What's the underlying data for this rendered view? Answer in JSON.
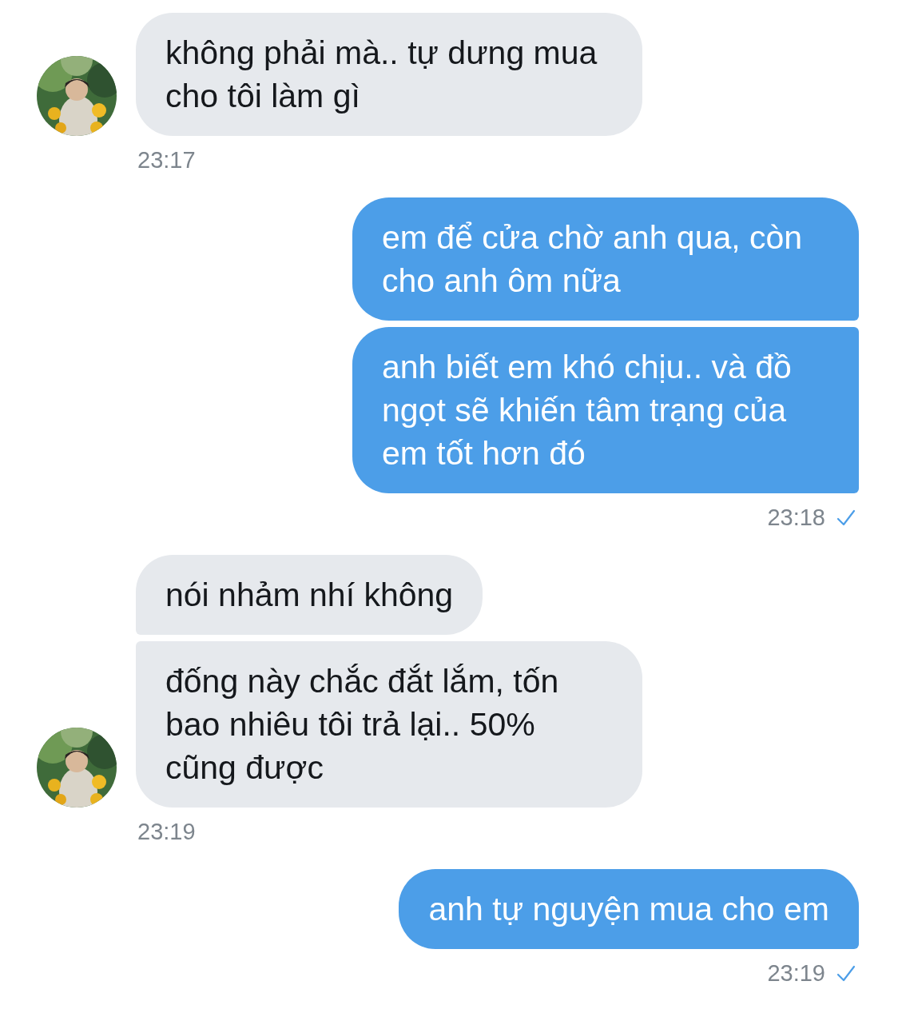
{
  "groups": [
    {
      "kind": "incoming",
      "messages": [
        "không phải mà.. tự dưng mua cho tôi làm gì"
      ],
      "time": "23:17",
      "read": false
    },
    {
      "kind": "outgoing",
      "messages": [
        "em để cửa chờ anh qua, còn cho anh ôm nữa",
        "anh biết em khó chịu.. và đồ ngọt sẽ khiến tâm trạng của em tốt hơn đó"
      ],
      "time": "23:18",
      "read": true
    },
    {
      "kind": "incoming",
      "messages": [
        "nói nhảm nhí không",
        "đống này chắc đắt lắm, tốn bao nhiêu tôi trả lại.. 50% cũng được"
      ],
      "time": "23:19",
      "read": false
    },
    {
      "kind": "outgoing",
      "messages": [
        "anh tự nguyện mua cho em"
      ],
      "time": "23:19",
      "read": true
    }
  ]
}
